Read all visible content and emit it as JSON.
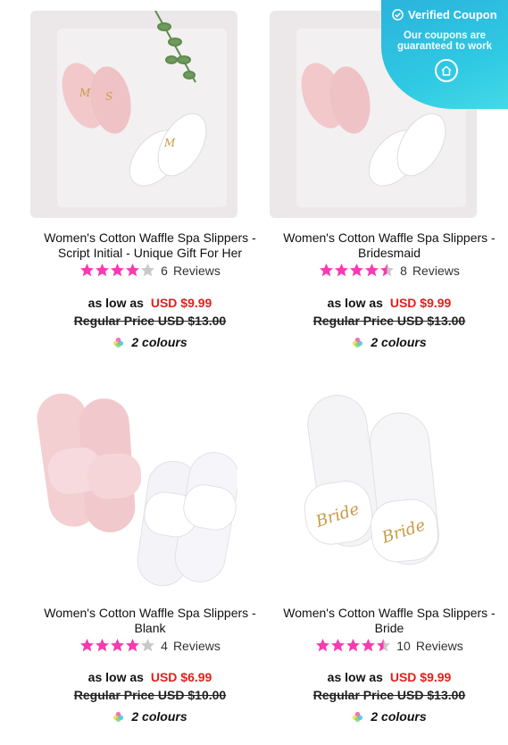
{
  "products": [
    {
      "title_line1": "Women's Cotton Waffle Spa Slippers -",
      "title_line2": "Script Initial - Unique Gift For Her",
      "rating": 4,
      "reviews_count": "6",
      "reviews_label": "Reviews",
      "as_low_as": "as low as",
      "price": "USD $9.99",
      "regular_price": "Regular Price USD $13.00",
      "colours": "2 colours"
    },
    {
      "title_line1": "Women's Cotton Waffle Spa Slippers -",
      "title_line2": "Bridesmaid",
      "rating": 4.5,
      "reviews_count": "8",
      "reviews_label": "Reviews",
      "as_low_as": "as low as",
      "price": "USD $9.99",
      "regular_price": "Regular Price USD $13.00",
      "colours": "2 colours"
    },
    {
      "title_line1": "Women's Cotton Waffle Spa Slippers -",
      "title_line2": "Blank",
      "rating": 4,
      "reviews_count": "4",
      "reviews_label": "Reviews",
      "as_low_as": "as low as",
      "price": "USD $6.99",
      "regular_price": "Regular Price USD $10.00",
      "colours": "2 colours"
    },
    {
      "title_line1": "Women's Cotton Waffle Spa Slippers -",
      "title_line2": "Bride",
      "rating": 4.5,
      "reviews_count": "10",
      "reviews_label": "Reviews",
      "as_low_as": "as low as",
      "price": "USD $9.99",
      "regular_price": "Regular Price USD $13.00",
      "colours": "2 colours"
    }
  ],
  "coupon": {
    "title": "Verified Coupon",
    "line1": "Our coupons are",
    "line2": "guaranteed to work"
  },
  "colors": {
    "star": "#f53bb0",
    "star_empty": "#c8c8c8",
    "price": "#e0211b",
    "coupon_bg": "#2fc8e3"
  }
}
